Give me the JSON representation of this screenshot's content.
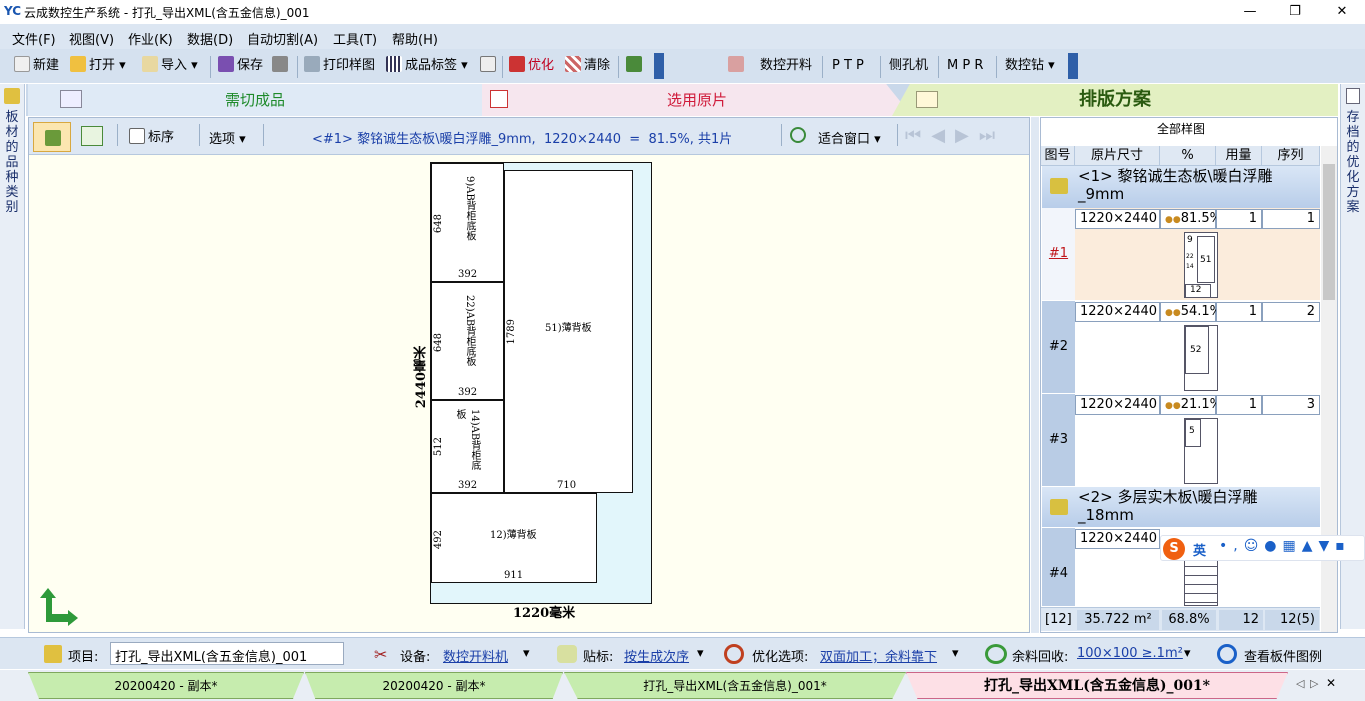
{
  "window": {
    "logo": "YC",
    "title": "云成数控生产系统 - 打孔_导出XML(含五金信息)_001",
    "min": "—",
    "max": "❐",
    "close": "✕"
  },
  "menu": [
    "文件(F)",
    "视图(V)",
    "作业(K)",
    "数据(D)",
    "自动切割(A)",
    "工具(T)",
    "帮助(H)"
  ],
  "toolbar": {
    "new": "新建",
    "open": "打开",
    "import": "导入",
    "save": "保存",
    "print_sample": "打印样图",
    "labels": "成品标签",
    "optimize": "优化",
    "clear": "清除",
    "cnc_cut": "数控开料",
    "ptp": "P T P",
    "side_drill": "侧孔机",
    "mpr": "M P R",
    "cnc_drill": "数控钻"
  },
  "left_strip": "板材的品种类别",
  "right_strip": "存档的优化方案",
  "tabs": {
    "t1": "需切成品",
    "t2": "选用原片",
    "t3": "排版方案"
  },
  "content_toolbar": {
    "order": "标序",
    "options": "选项",
    "info": "<#1> 黎铭诚生态板\\暖白浮雕_9mm,  1220×2440  =  81.5%, 共1片",
    "fit": "适合窗口"
  },
  "sheet": {
    "height_label": "2440毫米",
    "width_label": "1220毫米",
    "parts": [
      {
        "label": "9)AB背柜底板",
        "w": "392",
        "h": "648"
      },
      {
        "label": "22)AB背柜底板",
        "w": "392",
        "h": "648"
      },
      {
        "label": "14)AB背柜底板",
        "w": "392",
        "h": "512"
      },
      {
        "label": "51)薄背板",
        "w": "710",
        "h": "1789"
      },
      {
        "label": "12)薄背板",
        "w": "911",
        "h": "492"
      }
    ]
  },
  "right_panel": {
    "title": "全部样图",
    "headers": [
      "图号",
      "原片尺寸",
      "%",
      "用量",
      "序列"
    ],
    "group1": "<1> 黎铭诚生态板\\暖白浮雕_9mm",
    "group2": "<2> 多层实木板\\暖白浮雕_18mm",
    "rows": [
      {
        "id": "#1",
        "size": "1220×2440",
        "pct": "81.5%",
        "qty": "1",
        "seq": "1",
        "thumb": [
          "9",
          "51",
          "12",
          "22",
          "14"
        ]
      },
      {
        "id": "#2",
        "size": "1220×2440",
        "pct": "54.1%",
        "qty": "1",
        "seq": "2",
        "thumb": [
          "52"
        ]
      },
      {
        "id": "#3",
        "size": "1220×2440",
        "pct": "21.1%",
        "qty": "1",
        "seq": "3",
        "thumb": [
          "5"
        ]
      },
      {
        "id": "#4",
        "size": "1220×2440",
        "pct": "",
        "qty": "",
        "seq": "",
        "thumb": []
      }
    ],
    "footer": {
      "count": "[12]",
      "area": "35.722 m²",
      "pct": "68.8%",
      "qty": "12",
      "seq": "12(5)"
    }
  },
  "bottom": {
    "project_label": "项目:",
    "project_value": "打孔_导出XML(含五金信息)_001",
    "device_label": "设备:",
    "device_value": "数控开料机",
    "label_label": "贴标:",
    "label_value": "按生成次序",
    "opt_label": "优化选项:",
    "opt_value": "双面加工；余料靠下",
    "recycle_label": "余料回收:",
    "recycle_value": "100×100 ≥.1m²",
    "view": "查看板件图例"
  },
  "doc_tabs": [
    "20200420 - 副本*",
    "20200420 - 副本*",
    "打孔_导出XML(含五金信息)_001*",
    "打孔_导出XML(含五金信息)_001*"
  ],
  "ime": {
    "label": "英"
  },
  "colors": {
    "accent": "#1a3fa8",
    "tab_active": "#e3f0c2",
    "row_selected": "#fbecdc"
  }
}
